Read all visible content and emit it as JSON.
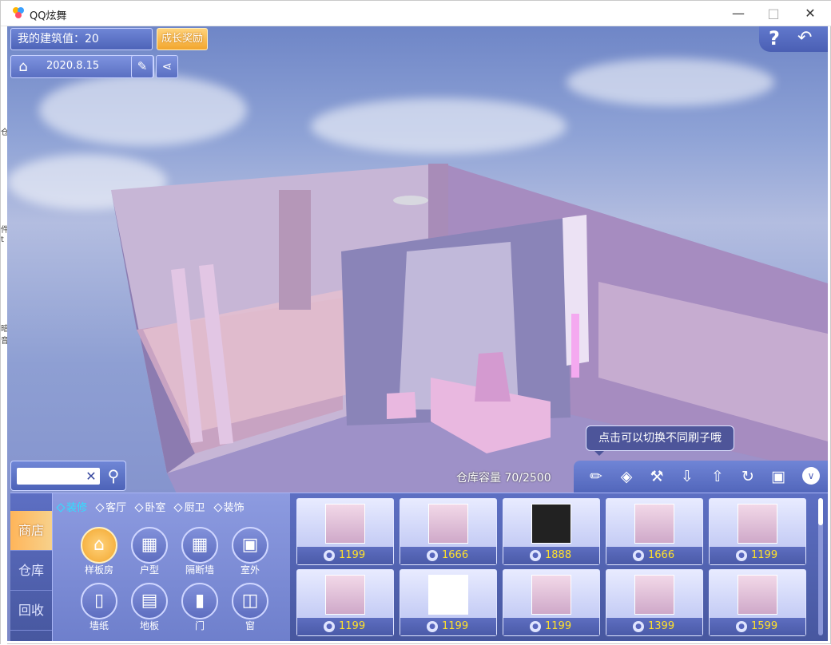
{
  "window": {
    "title": "QQ炫舞"
  },
  "hud": {
    "build_value": "我的建筑值：20",
    "growth_reward": "成长奖励",
    "date": "2020.8.15"
  },
  "hint": "点击可以切换不同刷子哦",
  "capacity": "仓库容量  70/2500",
  "search": {
    "value": "",
    "placeholder": ""
  },
  "side_tabs": [
    "商店",
    "仓库",
    "回收"
  ],
  "subtabs": [
    "装修",
    "客厅",
    "卧室",
    "厨卫",
    "装饰"
  ],
  "categories": [
    "样板房",
    "户型",
    "隔断墙",
    "室外",
    "墙纸",
    "地板",
    "门",
    "窗"
  ],
  "items": [
    {
      "price": "1199"
    },
    {
      "price": "1666"
    },
    {
      "price": "1888"
    },
    {
      "price": "1666"
    },
    {
      "price": "1199"
    },
    {
      "price": "1199"
    },
    {
      "price": "1199"
    },
    {
      "price": "1199"
    },
    {
      "price": "1399"
    },
    {
      "price": "1599"
    }
  ],
  "colors": {
    "accent": "#5d6fc3",
    "price": "#ffe12a",
    "active_tab": "#f7b35a"
  }
}
